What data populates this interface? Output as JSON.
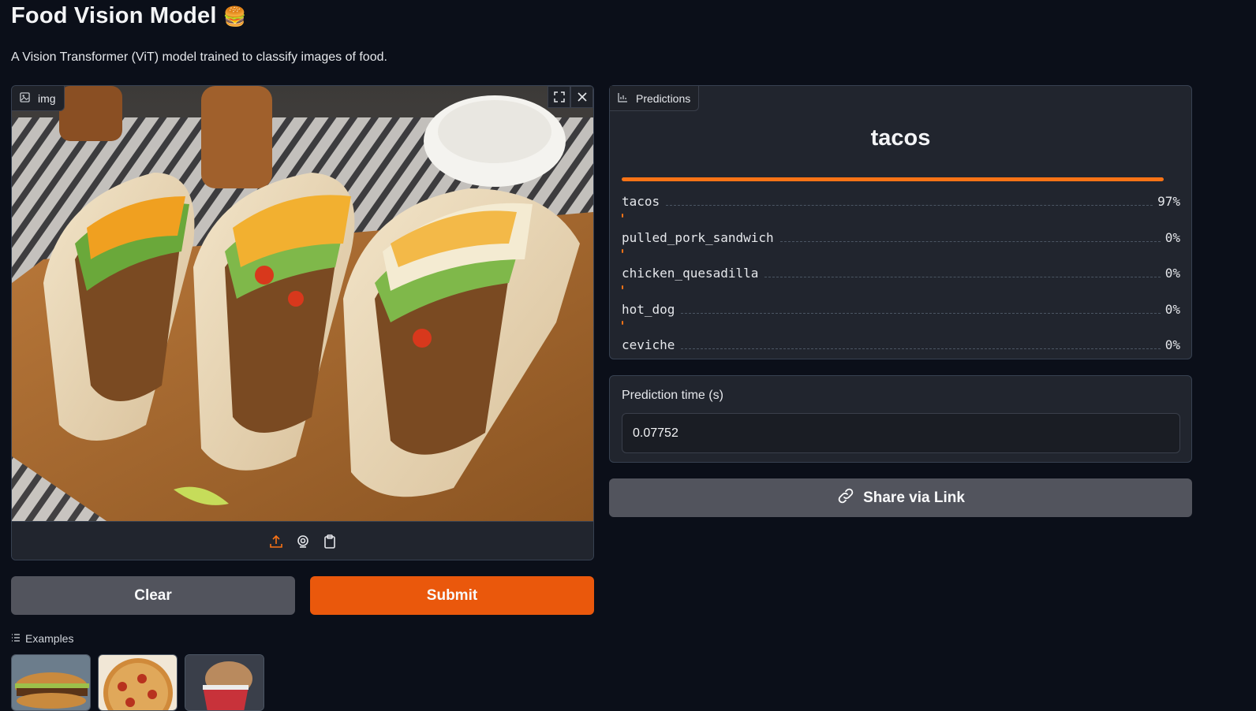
{
  "header": {
    "title": "Food Vision Model",
    "title_emoji": "🍔",
    "description": "A Vision Transformer (ViT) model trained to classify images of food."
  },
  "image_input": {
    "label": "img",
    "label_icon": "image-icon",
    "top_icons": [
      "fullscreen-icon",
      "close-icon"
    ],
    "toolbar_icons": [
      "upload-icon",
      "webcam-icon",
      "clipboard-icon"
    ],
    "content": "photo of three tacos on a wooden board"
  },
  "buttons": {
    "clear_label": "Clear",
    "submit_label": "Submit",
    "share_label": "Share via Link"
  },
  "examples": {
    "label": "Examples",
    "items": [
      "hamburger",
      "pizza",
      "ice_cream"
    ]
  },
  "predictions": {
    "label": "Predictions",
    "top_label": "tacos",
    "rows": [
      {
        "name": "tacos",
        "pct": "97%",
        "fraction": 0.97
      },
      {
        "name": "pulled_pork_sandwich",
        "pct": "0%",
        "fraction": 0.0
      },
      {
        "name": "chicken_quesadilla",
        "pct": "0%",
        "fraction": 0.0
      },
      {
        "name": "hot_dog",
        "pct": "0%",
        "fraction": 0.0
      },
      {
        "name": "ceviche",
        "pct": "0%",
        "fraction": 0.0
      }
    ]
  },
  "prediction_time": {
    "label": "Prediction time (s)",
    "value": "0.07752"
  },
  "colors": {
    "accent": "#ea580c",
    "bar": "#f97316",
    "background": "#0b0f19",
    "panel": "#21252e",
    "secondary_button": "#52545d"
  }
}
